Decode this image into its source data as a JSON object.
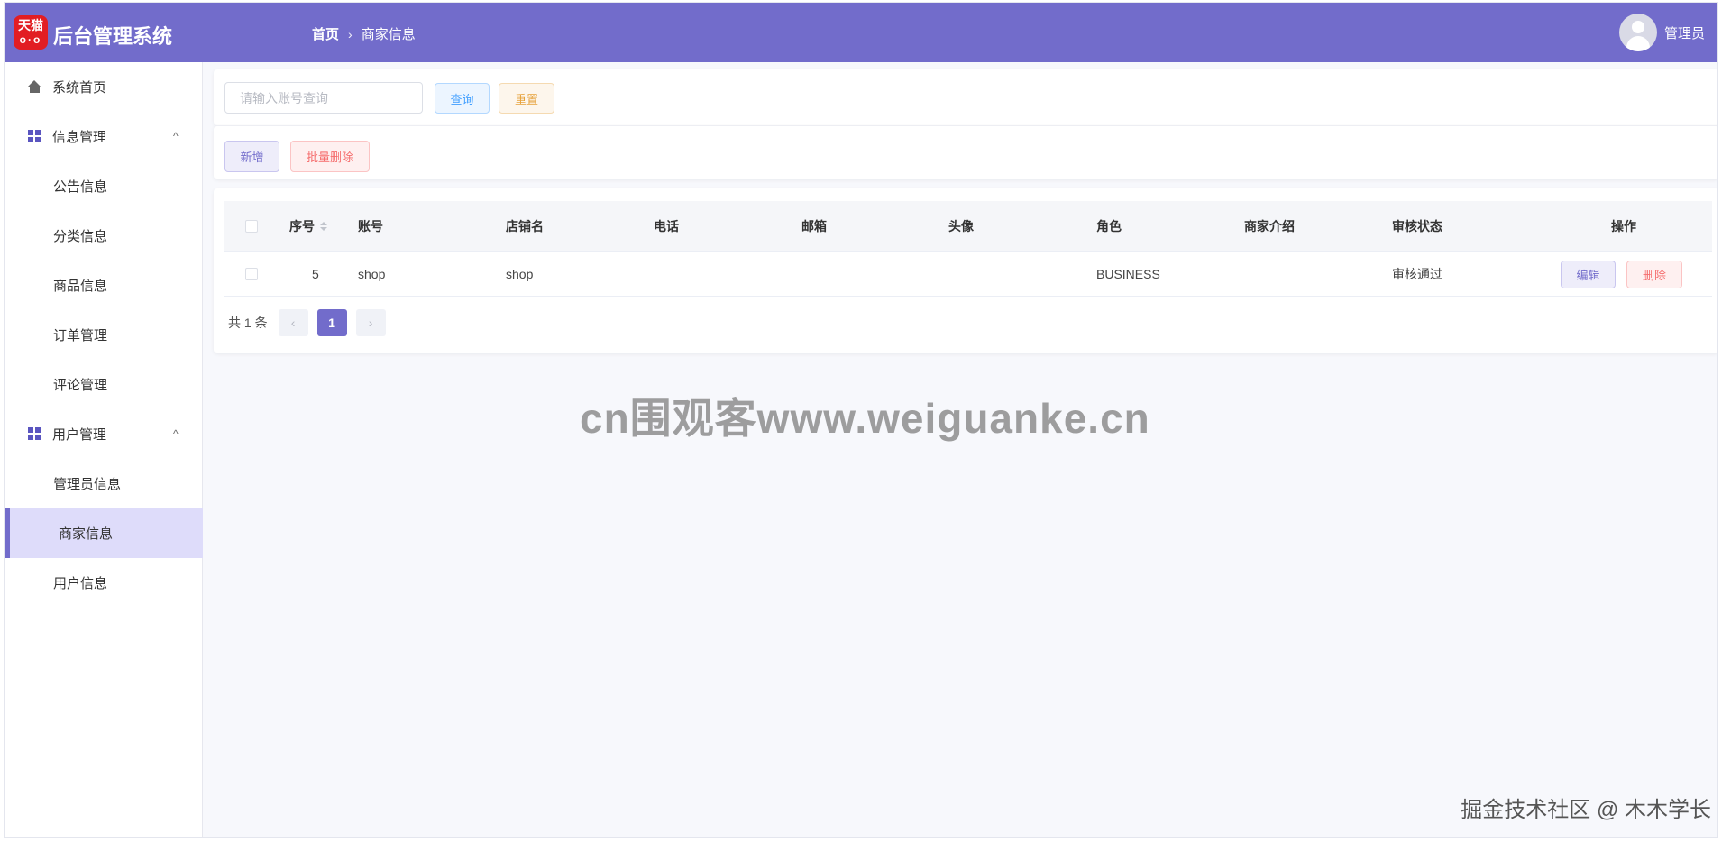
{
  "header": {
    "logo_text": "天猫",
    "logo_eyes": "o·o",
    "app_title": "后台管理系统",
    "breadcrumb_home": "首页",
    "breadcrumb_sep": "›",
    "breadcrumb_current": "商家信息",
    "user_name": "管理员"
  },
  "sidebar": {
    "home": "系统首页",
    "info_group": "信息管理",
    "info_items": [
      "公告信息",
      "分类信息",
      "商品信息",
      "订单管理",
      "评论管理"
    ],
    "user_group": "用户管理",
    "user_items": [
      "管理员信息",
      "商家信息",
      "用户信息"
    ],
    "chevron": "^"
  },
  "search": {
    "placeholder": "请输入账号查询",
    "query_label": "查询",
    "reset_label": "重置"
  },
  "toolbar": {
    "add_label": "新增",
    "batch_delete_label": "批量删除"
  },
  "table": {
    "columns": [
      "序号",
      "账号",
      "店铺名",
      "电话",
      "邮箱",
      "头像",
      "角色",
      "商家介绍",
      "审核状态",
      "操作"
    ],
    "rows": [
      {
        "id": "5",
        "account": "shop",
        "shop_name": "shop",
        "phone": "",
        "email": "",
        "avatar": "",
        "role": "BUSINESS",
        "intro": "",
        "status": "审核通过",
        "edit_label": "编辑",
        "delete_label": "删除"
      }
    ]
  },
  "pagination": {
    "total_text": "共 1 条",
    "prev": "‹",
    "current": "1",
    "next": "›"
  },
  "watermark": "cn围观客www.weiguanke.cn",
  "footer_mark": "掘金技术社区 @ 木木学长",
  "colors": {
    "primary": "#726ccb",
    "active_menu_bg": "#dedcfa"
  }
}
